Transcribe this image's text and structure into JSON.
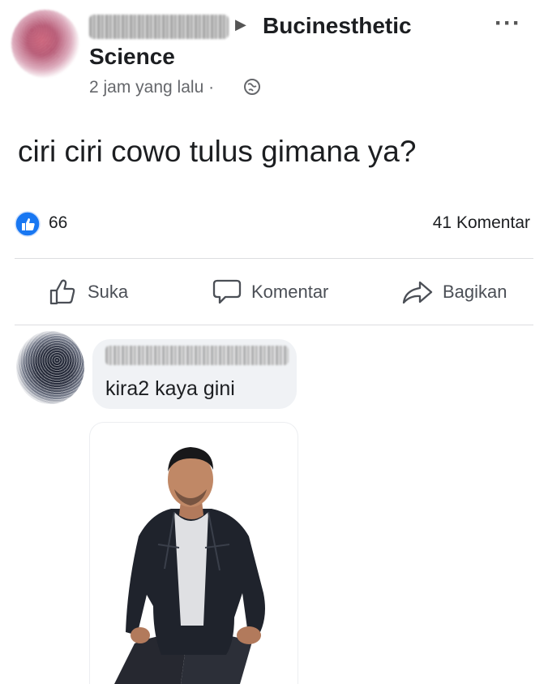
{
  "post": {
    "author_name": "",
    "group_line1": "Bucinesthetic",
    "group_line2": "Science",
    "time": "2 jam yang lalu",
    "separator": "·",
    "text": "ciri ciri cowo tulus gimana ya?"
  },
  "stats": {
    "likes": "66",
    "comments": "41 Komentar"
  },
  "actions": [
    {
      "label": "Suka",
      "icon": "thumbs-up-icon"
    },
    {
      "label": "Komentar",
      "icon": "comment-icon"
    },
    {
      "label": "Bagikan",
      "icon": "share-icon"
    }
  ],
  "comment": {
    "author_name": "",
    "text": "kira2 kaya gini"
  },
  "icons": {
    "more": "more-icon",
    "arrow": "arrow-right-icon",
    "privacy": "globe-icon",
    "like_badge": "like-badge-icon"
  },
  "colors": {
    "accent": "#1877f2",
    "text": "#1c1e21",
    "secondary": "#65676b",
    "bubble": "#f0f2f5"
  }
}
